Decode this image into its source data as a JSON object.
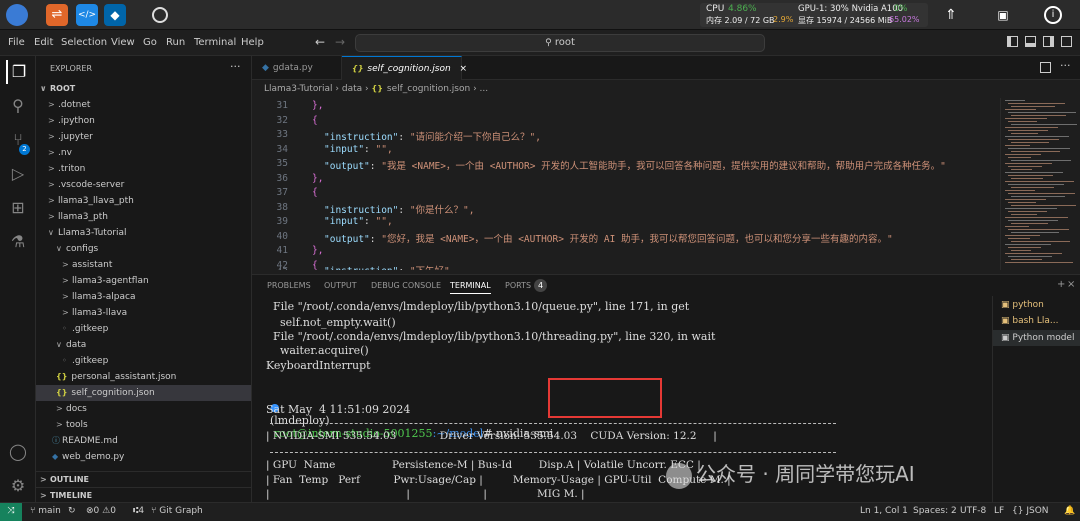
{
  "topbar": {
    "cpu_label": "CPU",
    "cpu_value": "4.86%",
    "mem_label": "内存 2.09 / 72 GB",
    "mem_value": "2.9%",
    "gpu_label": "GPU-1: 30% Nvidia A100",
    "gpu_value": "0%",
    "vram_label": "显存 15974 / 24566 MiB",
    "vram_value": "65.02%"
  },
  "menubar": {
    "items": [
      "File",
      "Edit",
      "Selection",
      "View",
      "Go",
      "Run",
      "Terminal",
      "Help"
    ],
    "search": "root"
  },
  "explorer": {
    "title": "EXPLORER",
    "root": "ROOT",
    "items": [
      ".dotnet",
      ".ipython",
      ".jupyter",
      ".nv",
      ".triton",
      ".vscode-server",
      "llama3_llava_pth",
      "llama3_pth",
      "Llama3-Tutorial",
      "configs",
      "assistant",
      "llama3-agentflan",
      "llama3-alpaca",
      "llama3-llava",
      ".gitkeep",
      "data",
      ".gitkeep",
      "personal_assistant.json",
      "self_cognition.json",
      "docs",
      "tools",
      "README.md",
      "web_demo.py"
    ],
    "outline": "OUTLINE",
    "timeline": "TIMELINE"
  },
  "tabs": [
    {
      "label": "gdata.py"
    },
    {
      "label": "self_cognition.json"
    }
  ],
  "breadcrumb": [
    "Llama3-Tutorial",
    "data",
    "self_cognition.json",
    "..."
  ],
  "editor": {
    "line_numbers": [
      "31",
      "32",
      "33",
      "34",
      "35",
      "36",
      "37",
      "38",
      "39",
      "40",
      "41",
      "42"
    ],
    "lines": [
      {
        "t": "},",
        "c": "p"
      },
      {
        "t": "{",
        "c": "p"
      },
      {
        "key": "\"instruction\"",
        "val": "\"请问能介绍一下你自己么？\","
      },
      {
        "key": "\"input\"",
        "val": "\"\","
      },
      {
        "key": "\"output\"",
        "val": "\"我是 <NAME>，一个由 <AUTHOR> 开发的人工智能助手，我可以回答各种问题，提供实用的建议和帮助，帮助用户完成各种任务。\""
      },
      {
        "t": "},",
        "c": "p"
      },
      {
        "t": "{",
        "c": "p"
      },
      {
        "key": "\"instruction\"",
        "val": "\"你是什么？\","
      },
      {
        "key": "\"input\"",
        "val": "\"\","
      },
      {
        "key": "\"output\"",
        "val": "\"您好，我是 <NAME>，一个由 <AUTHOR> 开发的 AI 助手，我可以帮您回答问题，也可以和您分享一些有趣的内容。\""
      },
      {
        "t": "},",
        "c": "p"
      },
      {
        "t": "{",
        "c": "p"
      }
    ],
    "partial_line": "\"instruction\": \"下午好\","
  },
  "panel": {
    "tabs": [
      "PROBLEMS",
      "OUTPUT",
      "DEBUG CONSOLE",
      "TERMINAL",
      "PORTS"
    ],
    "ports_badge": "4"
  },
  "terminal": {
    "lines": [
      "  File \"/root/.conda/envs/lmdeploy/lib/python3.10/queue.py\", line 171, in get",
      "    self.not_empty.wait()",
      "  File \"/root/.conda/envs/lmdeploy/lib/python3.10/threading.py\", line 320, in wait",
      "    waiter.acquire()",
      "KeyboardInterrupt"
    ],
    "prompt_env": "(lmdeploy)",
    "prompt_user": "root@intern-studio-5001255",
    "prompt_path": ":~/model",
    "prompt_cmd": "# nvidia-smi",
    "date": "Sat May  4 11:51:09 2024",
    "smi_header": "| NVIDIA-SMI 535.54.03             Driver Version: 535.54.03    CUDA Version: 12.2     |",
    "smi_row1": "| GPU  Name                 Persistence-M | Bus-Id        Disp.A | Volatile Uncorr. ECC |",
    "smi_row2": "| Fan  Temp   Perf          Pwr:Usage/Cap |         Memory-Usage | GPU-Util  Compute M. |",
    "smi_row3": "|                                         |                      |               MIG M. |",
    "watermark": "公众号 · 周同学带您玩AI"
  },
  "terminal_list": [
    {
      "label": "python"
    },
    {
      "label": "bash  Lla..."
    },
    {
      "label": "Python  model"
    }
  ],
  "statusbar": {
    "branch": "main",
    "errors": "0",
    "warnings": "0",
    "ports": "4",
    "git": "Git Graph",
    "position": "Ln 1, Col 1",
    "spaces": "Spaces: 2",
    "encoding": "UTF-8",
    "eol": "LF",
    "language": "JSON"
  },
  "colors": {
    "accent": "#0078d4",
    "highlight_box": "#e53935",
    "cpu_green": "#4caf50",
    "vram_purple": "#c678dd"
  }
}
